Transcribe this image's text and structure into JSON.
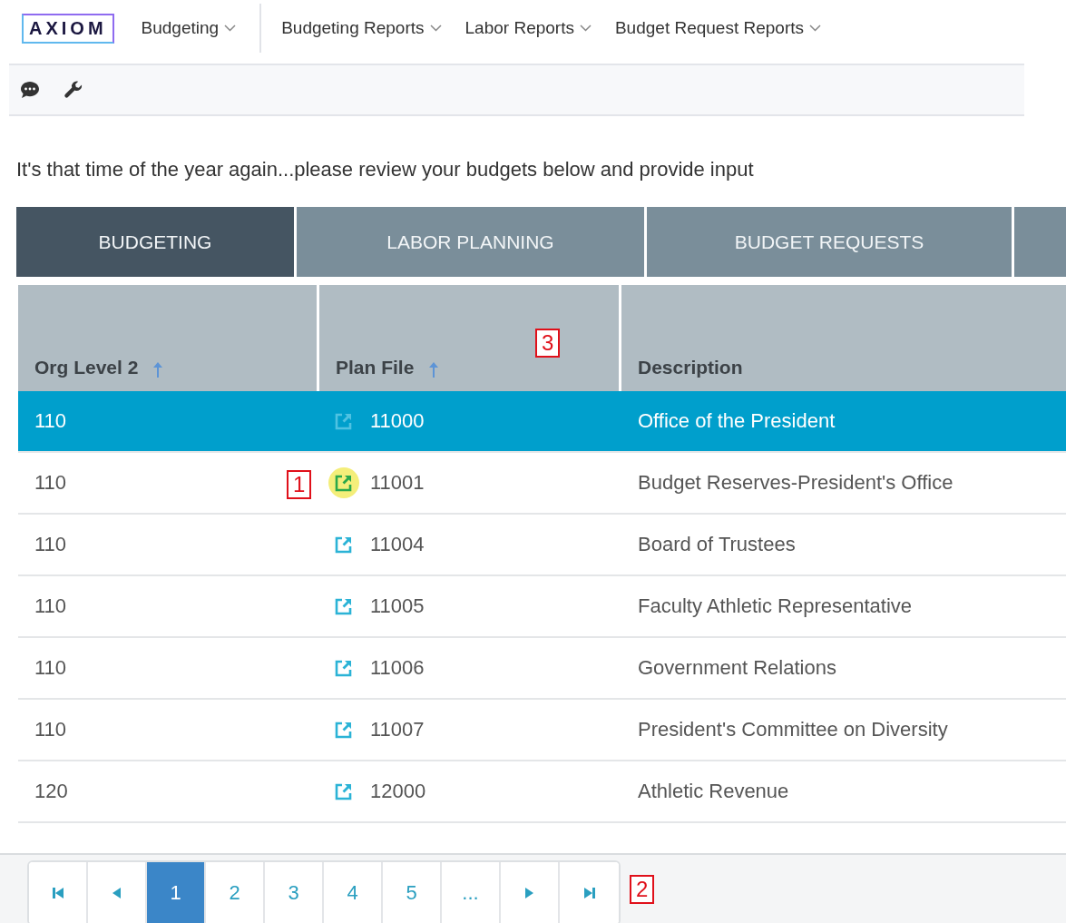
{
  "logo": "AXIOM",
  "nav": [
    {
      "label": "Budgeting"
    },
    {
      "label": "Budgeting Reports"
    },
    {
      "label": "Labor Reports"
    },
    {
      "label": "Budget Request Reports"
    }
  ],
  "intro": "It's that time of the year again...please review your budgets below and provide input",
  "tabs": [
    {
      "label": "BUDGETING",
      "selected": true
    },
    {
      "label": "LABOR PLANNING",
      "selected": false
    },
    {
      "label": "BUDGET REQUESTS",
      "selected": false
    },
    {
      "selected": false
    }
  ],
  "table": {
    "columns": [
      {
        "label": "Org Level 2",
        "sorted": true
      },
      {
        "label": "Plan File",
        "sorted": true,
        "callout": "3"
      },
      {
        "label": "Description",
        "sorted": false
      }
    ],
    "rows": [
      {
        "org": "110",
        "plan_file": "11000",
        "description": "Office of the President",
        "selected": true,
        "highlighted": false
      },
      {
        "org": "110",
        "plan_file": "11001",
        "description": "Budget Reserves-President's Office",
        "selected": false,
        "highlighted": true,
        "callout": "1"
      },
      {
        "org": "110",
        "plan_file": "11004",
        "description": "Board of Trustees",
        "selected": false,
        "highlighted": false
      },
      {
        "org": "110",
        "plan_file": "11005",
        "description": "Faculty Athletic Representative",
        "selected": false,
        "highlighted": false
      },
      {
        "org": "110",
        "plan_file": "11006",
        "description": "Government Relations",
        "selected": false,
        "highlighted": false
      },
      {
        "org": "110",
        "plan_file": "11007",
        "description": "President's Committee on Diversity",
        "selected": false,
        "highlighted": false
      },
      {
        "org": "120",
        "plan_file": "12000",
        "description": "Athletic Revenue",
        "selected": false,
        "highlighted": false
      }
    ]
  },
  "pager": {
    "pages": [
      {
        "label": "1",
        "selected": true
      },
      {
        "label": "2",
        "selected": false
      },
      {
        "label": "3",
        "selected": false
      },
      {
        "label": "4",
        "selected": false
      },
      {
        "label": "5",
        "selected": false
      },
      {
        "label": "...",
        "selected": false
      }
    ],
    "callout": "2"
  }
}
